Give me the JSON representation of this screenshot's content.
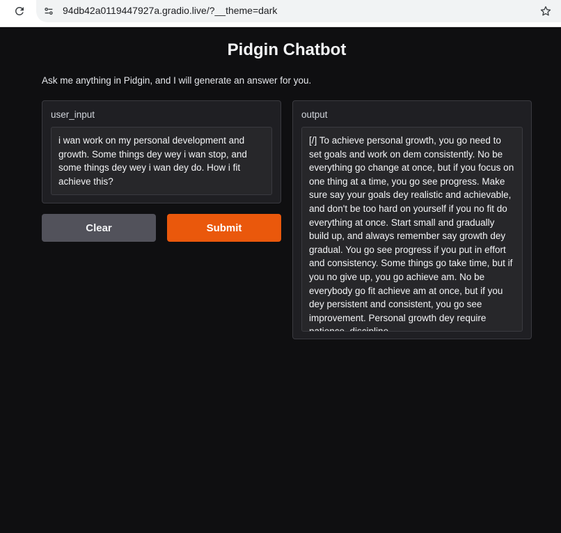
{
  "browser": {
    "url": "94db42a0119447927a.gradio.live/?__theme=dark"
  },
  "app": {
    "title": "Pidgin Chatbot",
    "description": "Ask me anything in Pidgin, and I will generate an answer for you."
  },
  "input": {
    "label": "user_input",
    "value": "i wan work on my personal development and growth. Some things dey wey i wan stop, and some things dey wey i wan dey do. How i fit achieve this?"
  },
  "output": {
    "label": "output",
    "value": "[/] To achieve personal growth, you go need to set goals and work on dem consistently. No be everything go change at once, but if you focus on one thing at a time, you go see progress. Make sure say your goals dey realistic and achievable, and don't be too hard on yourself if you no fit do everything at once. Start small and gradually build up, and always remember say growth dey gradual. You go see progress if you put in effort and consistency. Some things go take time, but if you no give up, you go achieve am. No be everybody go fit achieve am at once, but if you dey persistent and consistent, you go see improvement. Personal growth dey require patience, discipline"
  },
  "buttons": {
    "clear_label": "Clear",
    "submit_label": "Submit"
  },
  "colors": {
    "background": "#0f0f11",
    "panel": "#1f1f23",
    "submit": "#ea580c",
    "clear": "#52525b"
  },
  "icons": [
    "reload-icon",
    "site-info-icon",
    "bookmark-star-icon"
  ]
}
